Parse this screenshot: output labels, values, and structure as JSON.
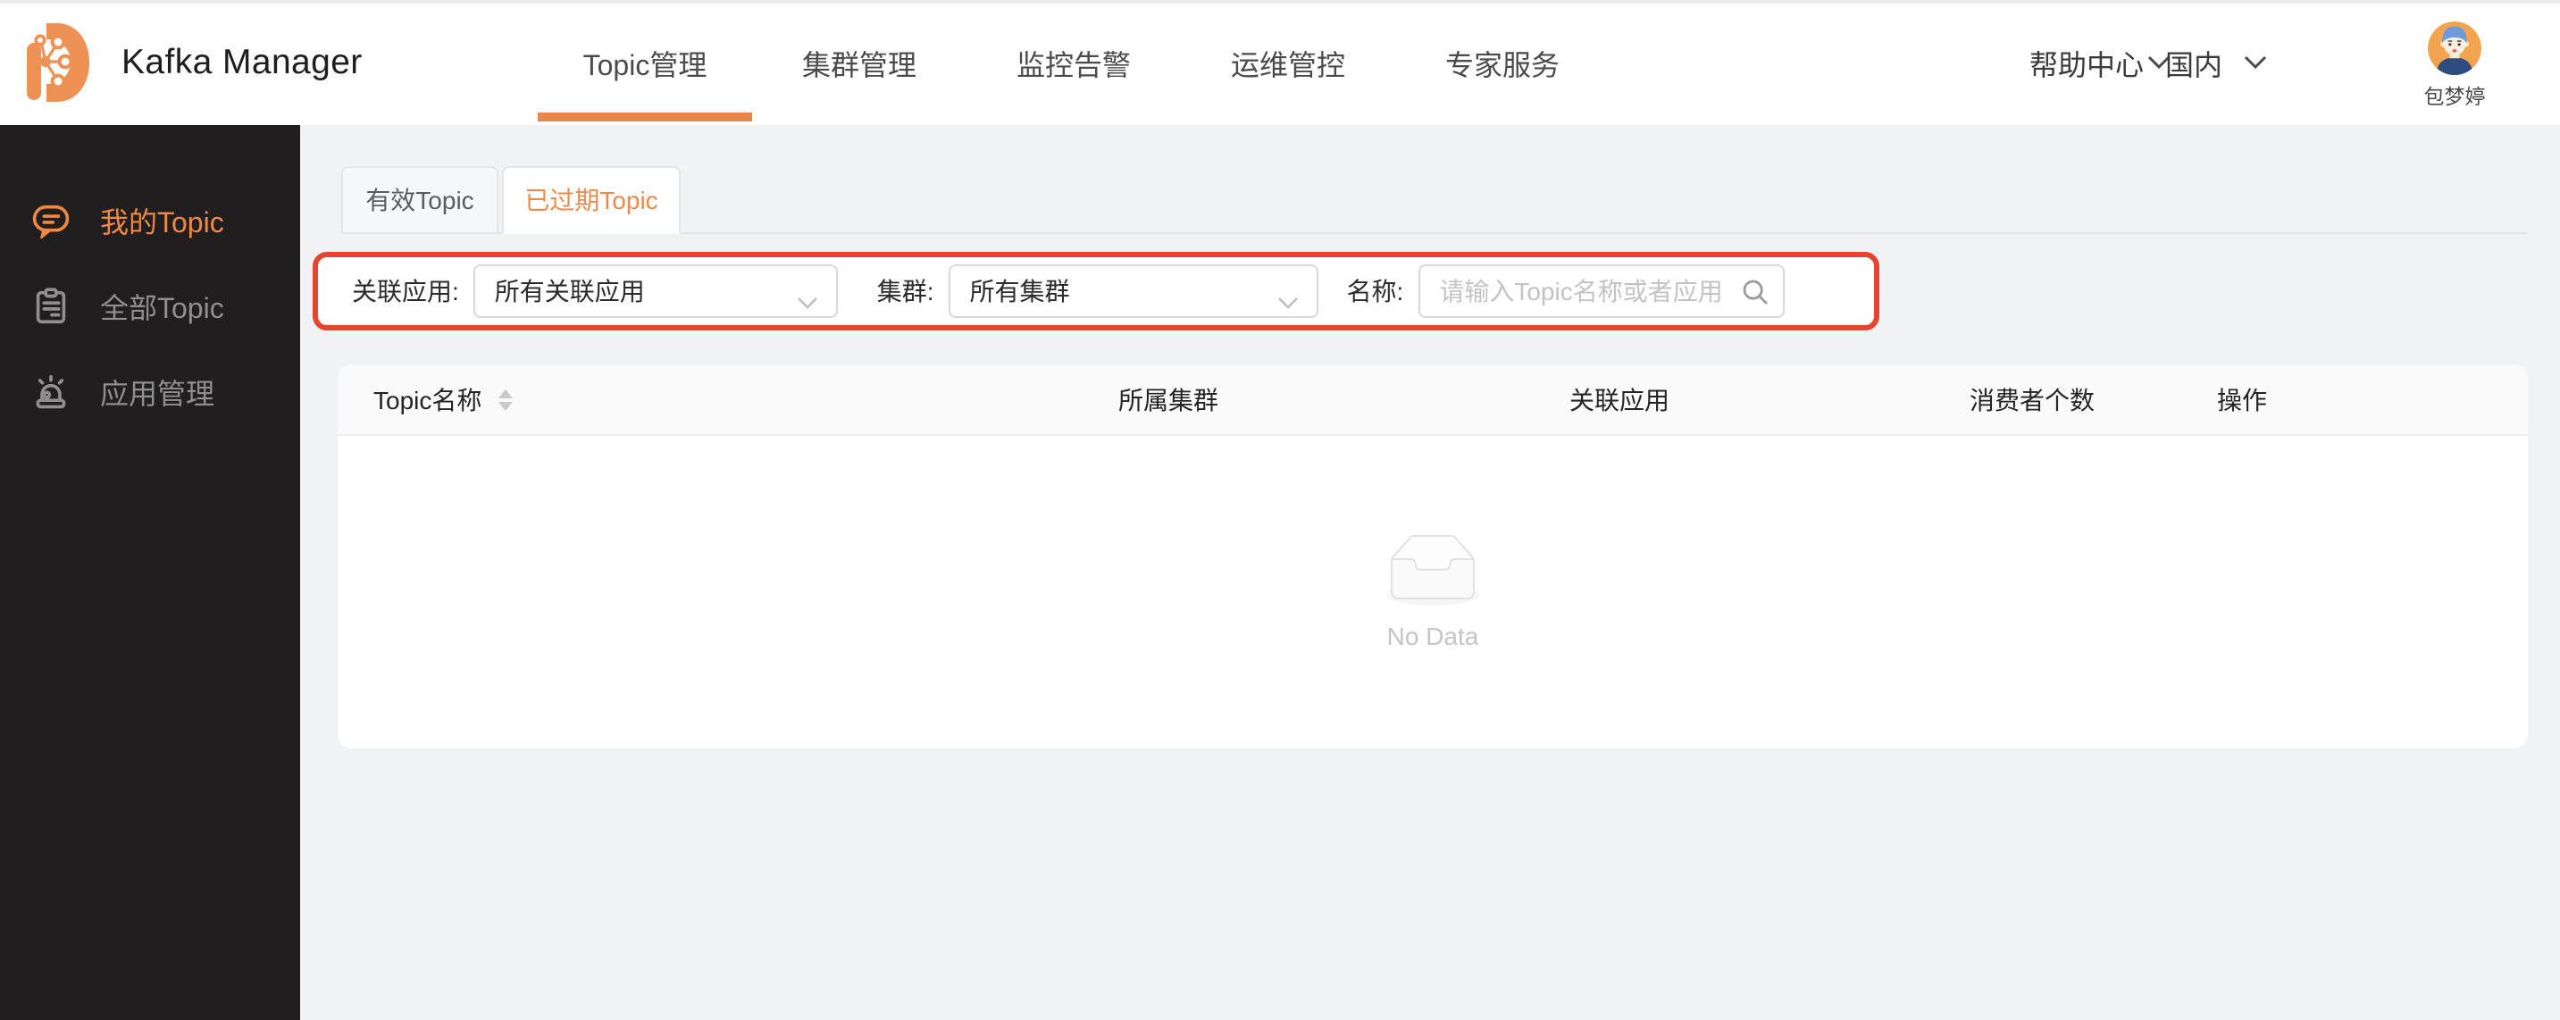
{
  "brand": {
    "title": "Kafka Manager"
  },
  "nav": {
    "active_index": 0,
    "items": [
      {
        "label": "Topic管理"
      },
      {
        "label": "集群管理"
      },
      {
        "label": "监控告警"
      },
      {
        "label": "运维管控"
      },
      {
        "label": "专家服务"
      }
    ]
  },
  "header_right": {
    "help_label": "帮助中心",
    "region_label": "国内",
    "user_name": "包梦婷"
  },
  "sidebar": {
    "active_index": 0,
    "items": [
      {
        "label": "我的Topic",
        "icon": "comment-icon"
      },
      {
        "label": "全部Topic",
        "icon": "clipboard-icon"
      },
      {
        "label": "应用管理",
        "icon": "app-alarm-icon"
      }
    ]
  },
  "tabs": {
    "active_index": 1,
    "items": [
      {
        "label": "有效Topic"
      },
      {
        "label": "已过期Topic"
      }
    ]
  },
  "filter_bar": {
    "app_label": "关联应用:",
    "app_value": "所有关联应用",
    "cluster_label": "集群:",
    "cluster_value": "所有集群",
    "name_label": "名称:",
    "name_placeholder": "请输入Topic名称或者应用"
  },
  "table": {
    "columns": [
      "Topic名称",
      "所属集群",
      "关联应用",
      "消费者个数",
      "操作"
    ],
    "rows": [],
    "empty_text": "No Data"
  },
  "colors": {
    "accent_orange": "#EE8A4E",
    "nav_underline": "#E8874A",
    "sidebar_active": "#F08843",
    "highlight_border": "#E8442D",
    "sidebar_bg": "#201E1E",
    "page_bg": "#F0F2F4",
    "header_row_bg": "#FAFAFA"
  }
}
